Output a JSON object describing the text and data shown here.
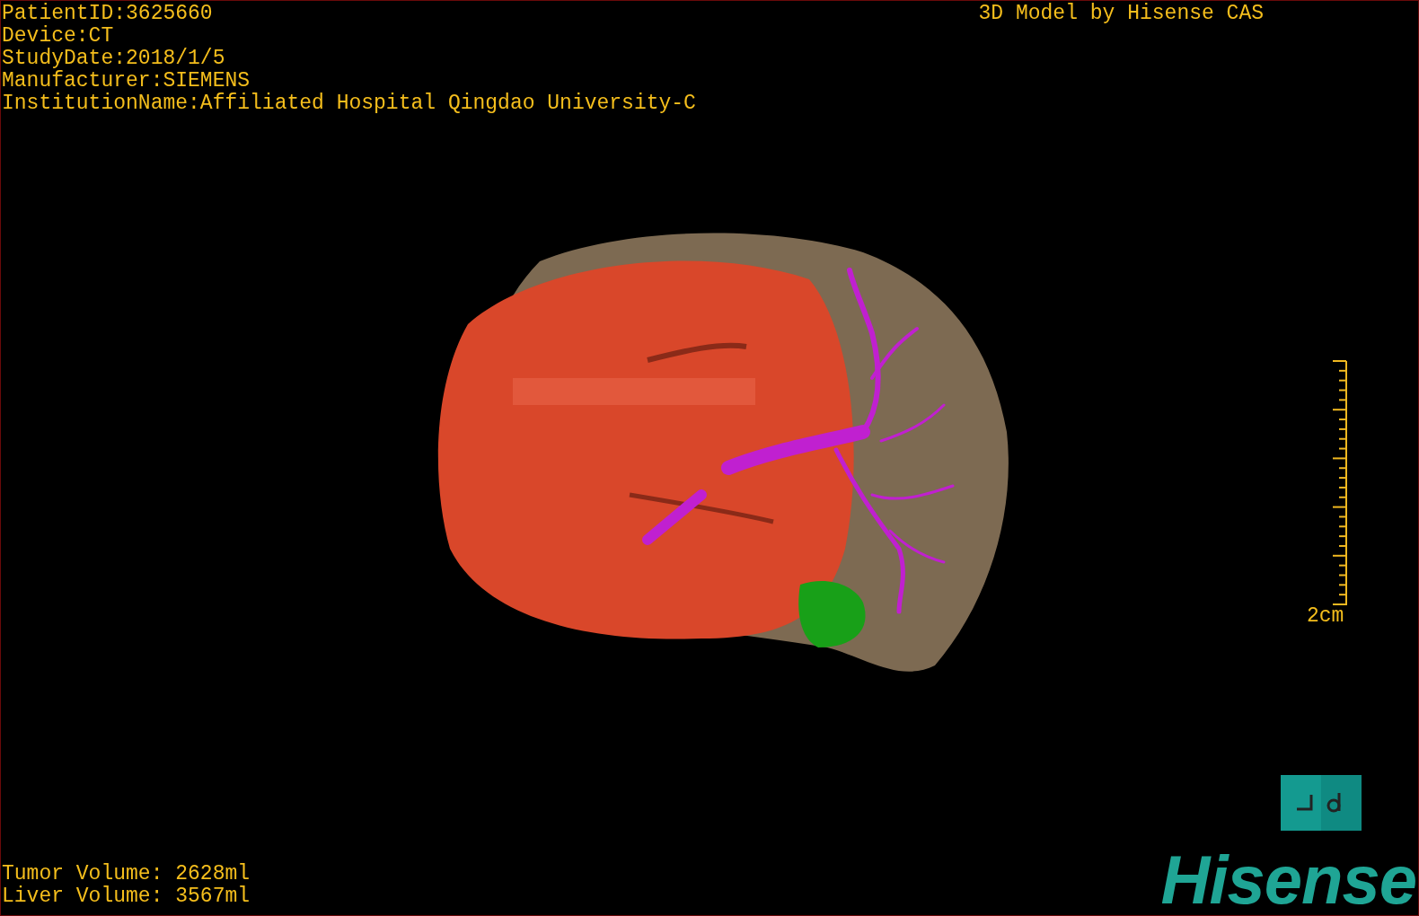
{
  "patient_info": [
    "PatientID:3625660",
    "Device:CT",
    "StudyDate:2018/1/5",
    "Manufacturer:SIEMENS",
    "InstitutionName:Affiliated Hospital Qingdao University-C"
  ],
  "title": "3D Model by Hisense CAS",
  "scale_bar": {
    "label": "2cm"
  },
  "volumes": [
    "Tumor Volume: 2628ml",
    "Liver Volume: 3567ml"
  ],
  "logo": "Hisense"
}
